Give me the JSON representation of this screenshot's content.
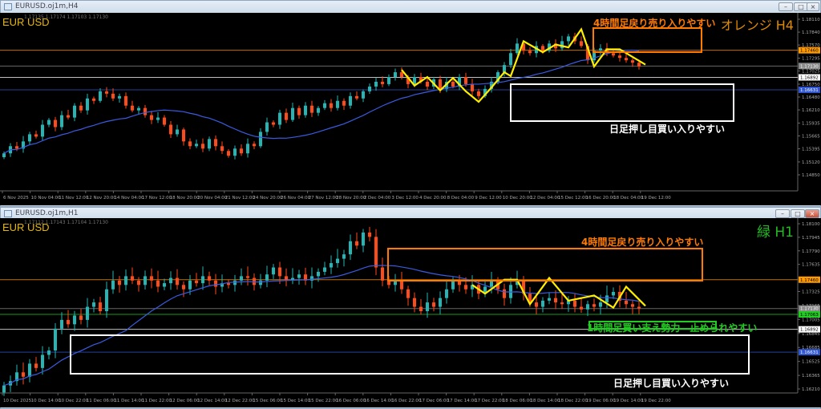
{
  "windows": [
    {
      "title": "EURUSD.oj1m,H4",
      "ohlc": "1.17135 1.17174 1.17103 1.17130",
      "symbol": "EUR USD",
      "label": "オレンジ H4",
      "label_color": "#e08a00",
      "annotations": {
        "orange_box": "4時間足戻り売り入りやすい",
        "white_box": "日足押し目買い入りやすい"
      }
    },
    {
      "title": "EURUSD.oj1m,H1",
      "ohlc": "1.17112 1.17143 1.17104 1.17130",
      "symbol": "EUR USD",
      "label": "緑 H1",
      "label_color": "#22bb22",
      "annotations": {
        "orange_box": "4時間足戻り売り入りやすい",
        "green_box": "1時間足買い支え勢力　止められやすい",
        "white_box": "日足押し目買い入りやすい"
      }
    }
  ],
  "colors": {
    "bull": "#26b5b5",
    "bear": "#ff4a1a",
    "ma": "#3a5be0",
    "zigzag": "#ffee00",
    "orange": "#ff7a00",
    "white": "#ffffff",
    "green": "#22cc22",
    "gray": "#8a8a8a",
    "blue": "#2f56d0"
  },
  "chart_data": [
    {
      "type": "candlestick",
      "timeframe": "H4",
      "ylim": [
        1.1485,
        1.1811
      ],
      "y_ticks": [
        "1.18110",
        "1.17840",
        "1.17570",
        "1.17295",
        "1.17025",
        "1.16750",
        "1.16480",
        "1.16210",
        "1.15935",
        "1.15665",
        "1.15395",
        "1.15120",
        "1.14850"
      ],
      "x_ticks": [
        "6 Nov 2025",
        "10 Nov 04:00",
        "11 Nov 12:00",
        "12 Nov 20:00",
        "14 Nov 04:00",
        "17 Nov 12:00",
        "18 Nov 20:00",
        "20 Nov 04:00",
        "21 Nov 12:00",
        "24 Nov 20:00",
        "26 Nov 04:00",
        "27 Nov 12:00",
        "28 Nov 20:00",
        "2 Dec 04:00",
        "3 Dec 12:00",
        "4 Dec 20:00",
        "8 Dec 04:00",
        "9 Dec 12:00",
        "10 Dec 20:00",
        "12 Dec 04:00",
        "15 Dec 12:00",
        "16 Dec 20:00",
        "18 Dec 04:00",
        "19 Dec 12:00"
      ],
      "closes": [
        1.153,
        1.1545,
        1.154,
        1.1555,
        1.157,
        1.1565,
        1.159,
        1.16,
        1.1585,
        1.161,
        1.1605,
        1.163,
        1.162,
        1.1645,
        1.164,
        1.166,
        1.1655,
        1.1645,
        1.165,
        1.163,
        1.162,
        1.1625,
        1.161,
        1.16,
        1.1605,
        1.159,
        1.157,
        1.158,
        1.1555,
        1.1545,
        1.155,
        1.154,
        1.156,
        1.1545,
        1.1535,
        1.1525,
        1.154,
        1.153,
        1.155,
        1.1545,
        1.1575,
        1.1595,
        1.159,
        1.1615,
        1.16,
        1.1625,
        1.161,
        1.163,
        1.1615,
        1.1625,
        1.1635,
        1.1625,
        1.164,
        1.163,
        1.165,
        1.1645,
        1.166,
        1.167,
        1.168,
        1.1675,
        1.169,
        1.17,
        1.169,
        1.1675,
        1.169,
        1.168,
        1.167,
        1.1685,
        1.1665,
        1.168,
        1.167,
        1.169,
        1.1675,
        1.166,
        1.165,
        1.1665,
        1.168,
        1.17,
        1.1715,
        1.174,
        1.176,
        1.1745,
        1.174,
        1.1755,
        1.1745,
        1.176,
        1.175,
        1.1765,
        1.1775,
        1.1765,
        1.1755,
        1.1725,
        1.1745,
        1.175,
        1.174,
        1.1735,
        1.173,
        1.1725,
        1.172,
        1.1712
      ],
      "ma_period": 20,
      "zigzag": [
        [
          62,
          1.1705
        ],
        [
          64,
          1.1672
        ],
        [
          66,
          1.169
        ],
        [
          68,
          1.1662
        ],
        [
          70,
          1.1688
        ],
        [
          72,
          1.166
        ],
        [
          74,
          1.1638
        ],
        [
          76,
          1.1668
        ],
        [
          78,
          1.17
        ],
        [
          79,
          1.1692
        ],
        [
          81,
          1.1765
        ],
        [
          84,
          1.1742
        ],
        [
          86,
          1.1758
        ],
        [
          88,
          1.1752
        ],
        [
          90,
          1.179
        ],
        [
          92,
          1.1712
        ],
        [
          94,
          1.1748
        ],
        [
          96,
          1.1748
        ],
        [
          100,
          1.1716
        ]
      ],
      "h_lines": [
        {
          "price": "1.17460",
          "color": "#ff9a00"
        },
        {
          "price": "1.17130",
          "color": "#8a8a8a"
        },
        {
          "price": "1.16892",
          "color": "#ffffff"
        },
        {
          "price": "1.16631",
          "color": "#2f56d0"
        }
      ]
    },
    {
      "type": "candlestick",
      "timeframe": "H1",
      "ylim": [
        1.1621,
        1.181
      ],
      "y_ticks": [
        "1.18100",
        "1.17945",
        "1.17790",
        "1.17635",
        "1.17325",
        "1.17165",
        "1.17005",
        "1.16845",
        "1.16685",
        "1.16525",
        "1.16365",
        "1.16210"
      ],
      "x_ticks": [
        "10 Dec 2025",
        "10 Dec 14:00",
        "10 Dec 22:00",
        "11 Dec 06:00",
        "11 Dec 14:00",
        "11 Dec 22:00",
        "12 Dec 06:00",
        "12 Dec 14:00",
        "12 Dec 22:00",
        "15 Dec 06:00",
        "15 Dec 14:00",
        "15 Dec 22:00",
        "16 Dec 06:00",
        "16 Dec 14:00",
        "16 Dec 22:00",
        "17 Dec 06:00",
        "17 Dec 14:00",
        "17 Dec 22:00",
        "18 Dec 06:00",
        "18 Dec 14:00",
        "18 Dec 22:00",
        "19 Dec 06:00",
        "19 Dec 14:00",
        "19 Dec 22:00"
      ],
      "closes": [
        1.1625,
        1.163,
        1.164,
        1.1635,
        1.165,
        1.1645,
        1.166,
        1.1665,
        1.169,
        1.17,
        1.1695,
        1.1705,
        1.17,
        1.1715,
        1.172,
        1.171,
        1.1735,
        1.1745,
        1.174,
        1.175,
        1.1745,
        1.174,
        1.175,
        1.1745,
        1.1738,
        1.1742,
        1.1748,
        1.174,
        1.1735,
        1.1745,
        1.1742,
        1.175,
        1.1745,
        1.1738,
        1.1742,
        1.174,
        1.1745,
        1.175,
        1.1748,
        1.174,
        1.1745,
        1.1752,
        1.176,
        1.175,
        1.1745,
        1.1748,
        1.1752,
        1.1745,
        1.175,
        1.1755,
        1.176,
        1.1765,
        1.177,
        1.1775,
        1.179,
        1.1785,
        1.18,
        1.1795,
        1.176,
        1.1745,
        1.174,
        1.1745,
        1.1735,
        1.1725,
        1.1715,
        1.171,
        1.172,
        1.1715,
        1.1725,
        1.1735,
        1.1745,
        1.174,
        1.1735,
        1.174,
        1.173,
        1.1738,
        1.1745,
        1.1735,
        1.1725,
        1.174,
        1.1745,
        1.173,
        1.172,
        1.1715,
        1.1722,
        1.1725,
        1.172,
        1.1718,
        1.1722,
        1.1715,
        1.1712,
        1.1718,
        1.1715,
        1.172,
        1.1728,
        1.1732,
        1.1722,
        1.1718,
        1.1715,
        1.1713
      ],
      "ma_period": 20,
      "zigzag": [
        [
          73,
          1.174
        ],
        [
          75,
          1.173
        ],
        [
          78,
          1.1746
        ],
        [
          80,
          1.1746
        ],
        [
          82,
          1.1718
        ],
        [
          85,
          1.1748
        ],
        [
          88,
          1.1722
        ],
        [
          92,
          1.1728
        ],
        [
          95,
          1.1714
        ],
        [
          97,
          1.1738
        ],
        [
          100,
          1.1716
        ]
      ],
      "h_lines": [
        {
          "price": "1.17460",
          "color": "#ff9a00"
        },
        {
          "price": "1.17130",
          "color": "#8a8a8a"
        },
        {
          "price": "1.17063",
          "color": "#22cc22"
        },
        {
          "price": "1.16892",
          "color": "#ffffff"
        },
        {
          "price": "1.16631",
          "color": "#2f56d0"
        }
      ]
    }
  ]
}
